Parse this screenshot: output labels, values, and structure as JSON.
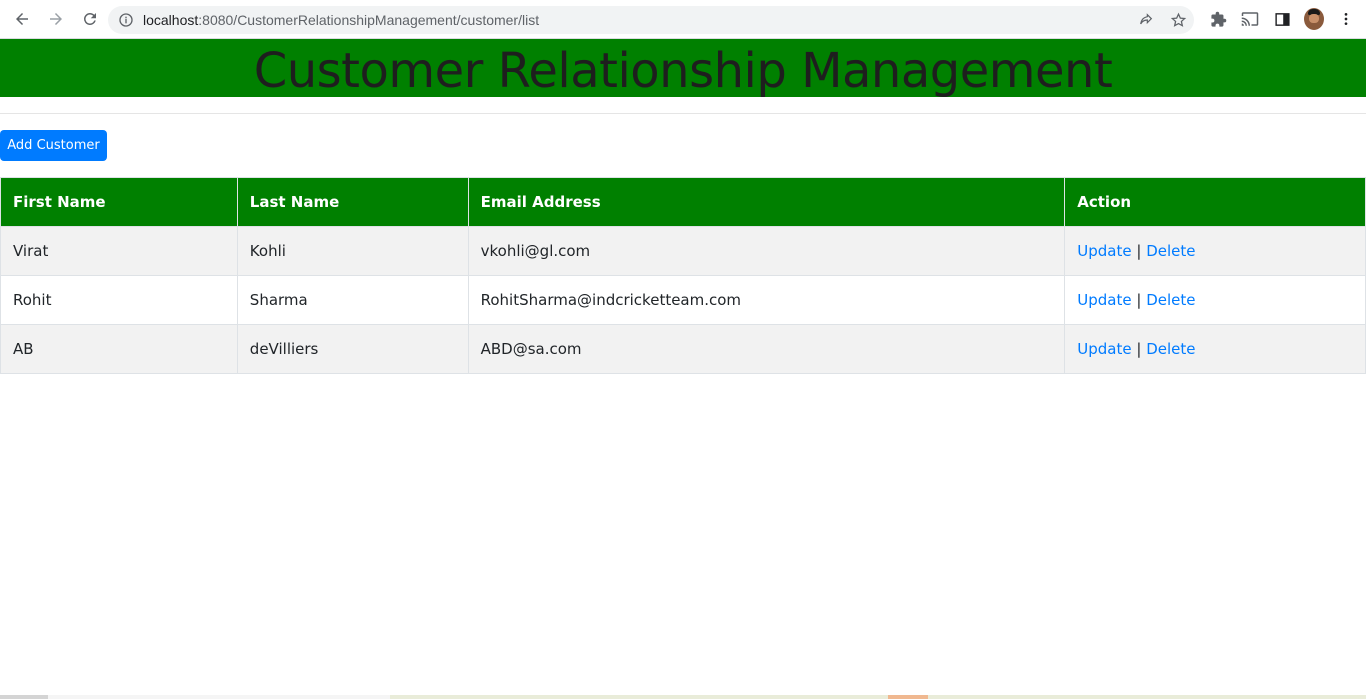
{
  "browser": {
    "url_host": "localhost",
    "url_path": ":8080/CustomerRelationshipManagement/customer/list"
  },
  "header": {
    "title": "Customer Relationship Management"
  },
  "actions": {
    "add_label": "Add Customer"
  },
  "table": {
    "headers": [
      "First Name",
      "Last Name",
      "Email Address",
      "Action"
    ],
    "rows": [
      {
        "first": "Virat",
        "last": "Kohli",
        "email": "vkohli@gl.com",
        "update": "Update",
        "sep": "|",
        "delete": "Delete"
      },
      {
        "first": "Rohit",
        "last": "Sharma",
        "email": "RohitSharma@indcricketteam.com",
        "update": "Update",
        "sep": "|",
        "delete": "Delete"
      },
      {
        "first": "AB",
        "last": "deVilliers",
        "email": "ABD@sa.com",
        "update": "Update",
        "sep": "|",
        "delete": "Delete"
      }
    ]
  },
  "colors": {
    "header_bg": "#008000",
    "button_bg": "#007bff",
    "link": "#007bff"
  },
  "icons": {
    "back": "arrow-left-icon",
    "forward": "arrow-right-icon",
    "reload": "reload-icon",
    "site_info": "info-icon",
    "share": "share-icon",
    "bookmark": "star-icon",
    "extensions": "puzzle-icon",
    "cast": "cast-icon",
    "side_panel": "side-panel-icon",
    "menu": "kebab-menu-icon"
  }
}
